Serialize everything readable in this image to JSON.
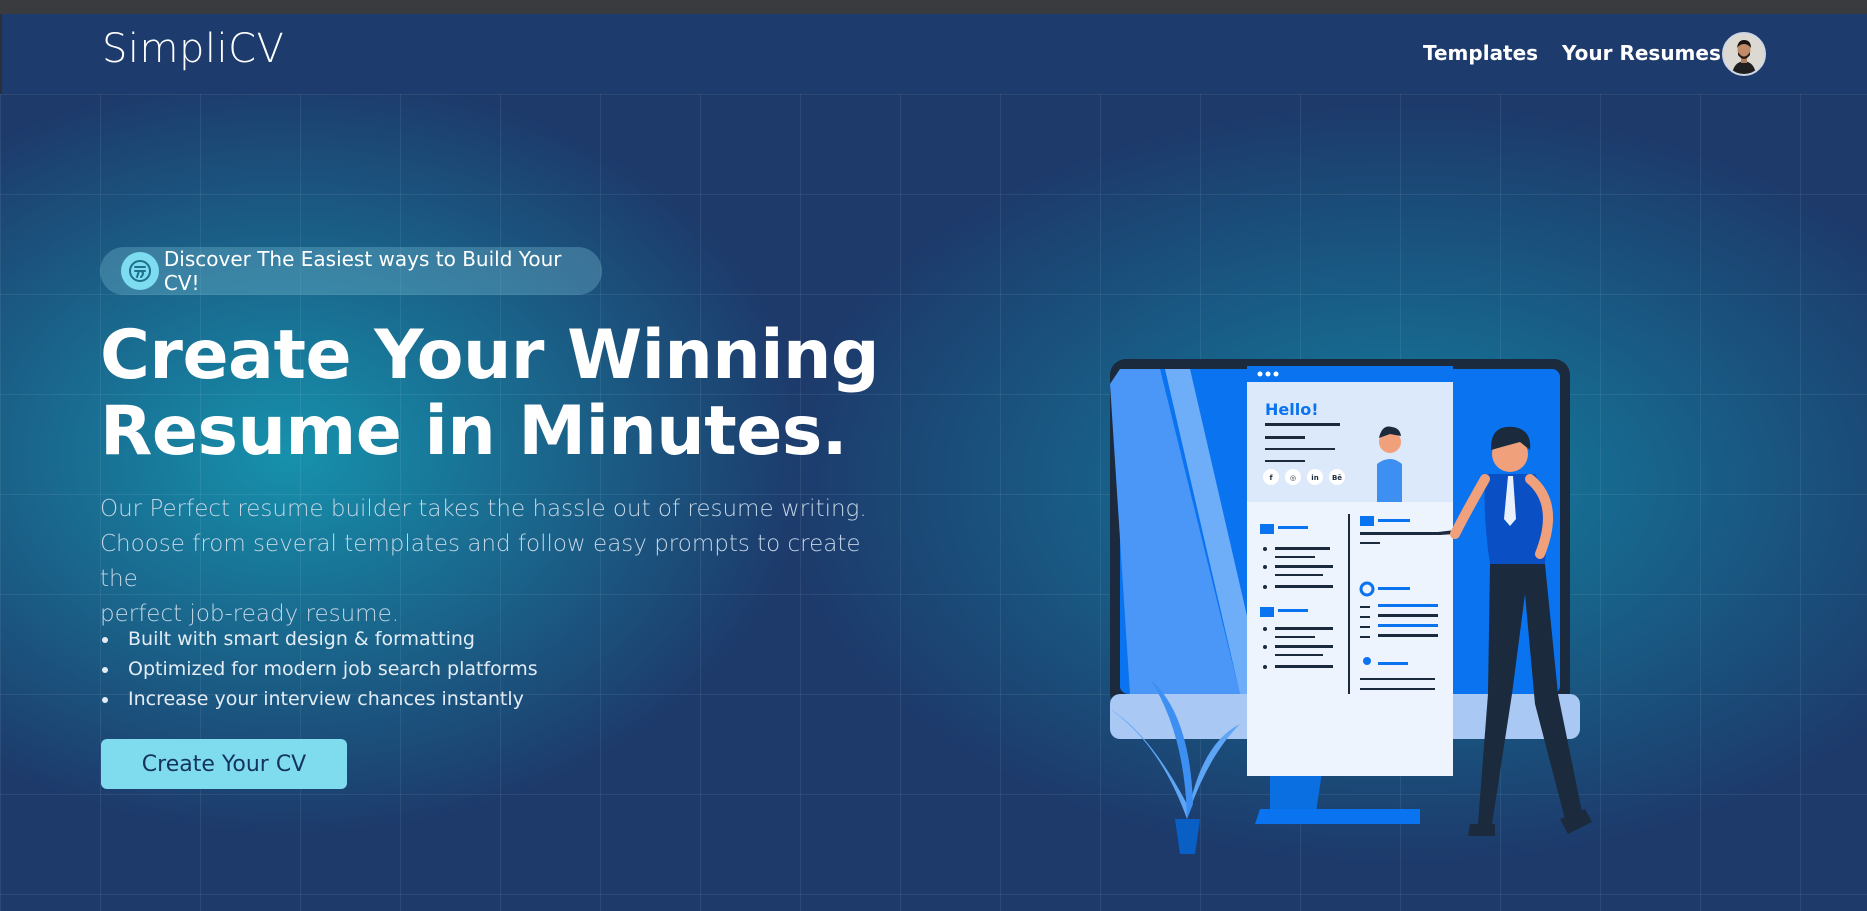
{
  "header": {
    "brand": "SimpliCV",
    "nav": [
      {
        "label": "Templates"
      },
      {
        "label": "Your Resumes"
      }
    ],
    "avatar": "avatar-photo"
  },
  "hero": {
    "badge_icon": "coin-logo-icon",
    "badge_text": "Discover The Easiest ways to Build Your CV!",
    "headline_line1": "Create Your Winning",
    "headline_line2": "Resume in Minutes.",
    "description_line1": "Our Perfect resume builder takes the hassle out of resume writing.",
    "description_line2": "Choose from several templates and follow easy prompts to create the",
    "description_line3": "perfect job-ready resume.",
    "features": [
      "Built with smart design & formatting",
      "Optimized for modern job search platforms",
      "Increase your interview chances instantly"
    ],
    "cta_label": "Create Your CV",
    "illustration": {
      "resume_greeting": "Hello!",
      "social_icons": [
        "f",
        "◎",
        "in",
        "Bē"
      ]
    }
  },
  "colors": {
    "navbar": "#1d3b6c",
    "background": "#1d3a6b",
    "glow": "#1696b0",
    "cta": "#7fdcef",
    "accent_blue": "#0a74f0"
  }
}
